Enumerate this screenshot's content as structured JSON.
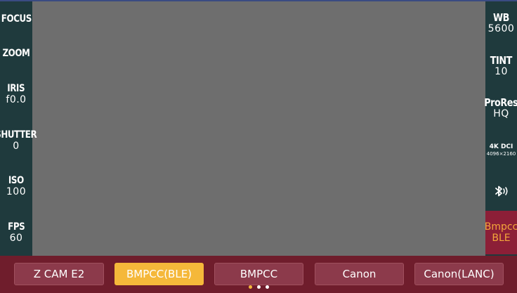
{
  "left_panel": {
    "focus": {
      "label": "FOCUS"
    },
    "zoom": {
      "label": "ZOOM"
    },
    "iris": {
      "label": "IRIS",
      "value": "f0.0"
    },
    "shutter": {
      "label": "SHUTTER",
      "value": "0"
    },
    "iso": {
      "label": "ISO",
      "value": "100"
    },
    "fps": {
      "label": "FPS",
      "value": "60"
    }
  },
  "right_panel": {
    "wb": {
      "label": "WB",
      "value": "5600"
    },
    "tint": {
      "label": "TINT",
      "value": "10"
    },
    "codec": {
      "label": "ProRes",
      "value": "HQ"
    },
    "resolution": {
      "label": "4K DCI",
      "value": "4096×2160"
    },
    "bluetooth": {
      "icon": "bluetooth-icon"
    },
    "connection": {
      "line1": "Bmpcc",
      "line2": "BLE"
    }
  },
  "cameras": {
    "items": [
      "Z CAM E2",
      "BMPCC(BLE)",
      "BMPCC",
      "Canon",
      "Canon(LANC)"
    ],
    "selected_index": 1
  },
  "pagination": {
    "pages": 3,
    "current": 0
  },
  "colors": {
    "sidebar": "#1f3a3d",
    "bottom_bar": "#6f1d2c",
    "button": "#8c3a4b",
    "accent": "#f5b83a",
    "active_panel": "#8c1f37"
  }
}
